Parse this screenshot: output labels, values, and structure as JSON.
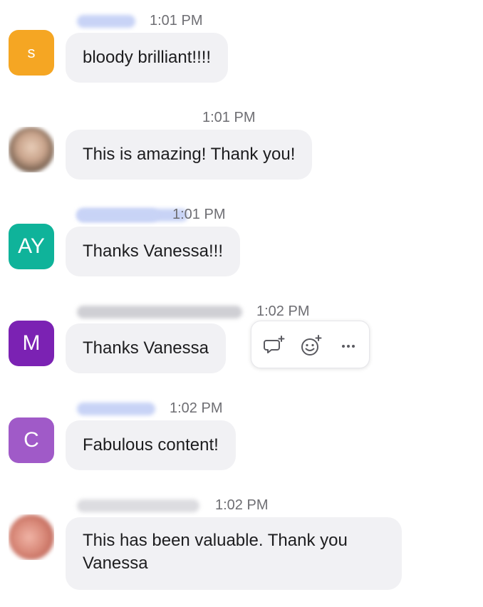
{
  "messages": [
    {
      "time": "1:01 PM",
      "text": "bloody brilliant!!!!",
      "avatar": {
        "type": "letter",
        "initials": "s",
        "color": "#f5a623"
      }
    },
    {
      "time": "1:01 PM",
      "text": "This is amazing! Thank you!",
      "avatar": {
        "type": "photo",
        "color": "#c9a48c"
      }
    },
    {
      "time": "1:01 PM",
      "text": "Thanks Vanessa!!!",
      "avatar": {
        "type": "letter",
        "initials": "AY",
        "color": "#0fb39a"
      }
    },
    {
      "time": "1:02 PM",
      "text": "Thanks Vanessa",
      "avatar": {
        "type": "letter",
        "initials": "M",
        "color": "#7b22b3"
      }
    },
    {
      "time": "1:02 PM",
      "text": "Fabulous content!",
      "avatar": {
        "type": "letter",
        "initials": "C",
        "color": "#a05ac8"
      }
    },
    {
      "time": "1:02 PM",
      "text": "This has been valuable. Thank you Vanessa",
      "avatar": {
        "type": "photo",
        "color": "#d98a7a"
      }
    }
  ],
  "hover_actions": {
    "icons": [
      "reply-in-thread-icon",
      "add-reaction-icon",
      "more-options-icon"
    ],
    "more_label": "···"
  },
  "colors": {
    "bubble_bg": "#f1f1f4",
    "timestamp": "#6e6e73",
    "icon_stroke": "#5a5a60"
  }
}
